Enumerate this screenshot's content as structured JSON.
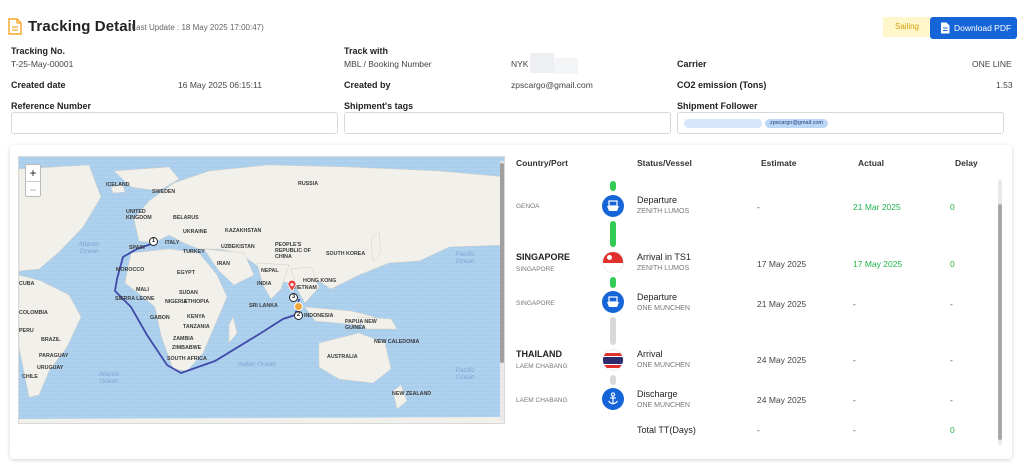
{
  "header": {
    "title": "Tracking Detail",
    "last_update": "(Last Update : 18 May 2025 17:00:47)",
    "status_badge": "Sailing",
    "download_label": "Download PDF"
  },
  "fields": {
    "tracking_no_label": "Tracking No.",
    "tracking_no": "T-25-May-00001",
    "track_with_label": "Track with",
    "track_with_type": "MBL / Booking Number",
    "track_with_value": "NYK",
    "carrier_label": "Carrier",
    "carrier": "ONE LINE",
    "created_date_label": "Created date",
    "created_date": "16 May 2025 06:15:11",
    "created_by_label": "Created by",
    "created_by": "zpscargo@gmail.com",
    "co2_label": "CO2 emission (Tons)",
    "co2": "1.53",
    "reference_label": "Reference Number",
    "tags_label": "Shipment's tags",
    "follower_label": "Shipment Follower",
    "follower_tag": "zpscargo@gmail.com"
  },
  "map": {
    "zoom_in": "+",
    "zoom_out": "−",
    "labels": [
      "ICELAND",
      "SWEDEN",
      "UNITED KINGDOM",
      "BELARUS",
      "UKRAINE",
      "SPAIN",
      "ITALY",
      "TURKEY",
      "KAZAKHSTAN",
      "UZBEKISTAN",
      "RUSSIA",
      "PEOPLE'S REPUBLIC OF CHINA",
      "SOUTH KOREA",
      "MOROCCO",
      "EGYPT",
      "IRAN",
      "NEPAL",
      "HONG KONG",
      "INDIA",
      "MALI",
      "NIGERIA",
      "SUDAN",
      "SIERRA LEONE",
      "ETHIOPIA",
      "SRI LANKA",
      "VIETNAM",
      "INDONESIA",
      "GABON",
      "KENYA",
      "TANZANIA",
      "ZAMBIA",
      "ZIMBABWE",
      "SOUTH AFRICA",
      "COLOMBIA",
      "PERU",
      "BRAZIL",
      "PARAGUAY",
      "CHILE",
      "URUGUAY",
      "CUBA",
      "PAPUA NEW GUINEA",
      "NEW CALEDONIA",
      "AUSTRALIA",
      "NEW ZEALAND",
      "Atlantic Ocean",
      "Atlantic Ocean",
      "Indian Ocean",
      "Pacific Ocean",
      "Pacific Ocean"
    ],
    "markers": [
      "1",
      "2",
      "3"
    ]
  },
  "table": {
    "headers": [
      "Country/Port",
      "Status/Vessel",
      "Estimate",
      "Actual",
      "Delay"
    ],
    "rows": [
      {
        "country": "",
        "port": "GENOA",
        "status": "Departure",
        "vessel": "ZENITH LUMOS",
        "estimate": "-",
        "actual": "21 Mar 2025",
        "delay": "0",
        "icon": "ship-icon"
      },
      {
        "country": "SINGAPORE",
        "port": "SINGAPORE",
        "status": "Arrival in TS1",
        "vessel": "ZENITH LUMOS",
        "estimate": "17 May 2025",
        "actual": "17 May 2025",
        "delay": "0",
        "icon": "singapore-flag-icon"
      },
      {
        "country": "",
        "port": "SINGAPORE",
        "status": "Departure",
        "vessel": "ONE MUNCHEN",
        "estimate": "21 May 2025",
        "actual": "-",
        "delay": "-",
        "icon": "ship-icon"
      },
      {
        "country": "THAILAND",
        "port": "LAEM CHABANG",
        "status": "Arrival",
        "vessel": "ONE MUNCHEN",
        "estimate": "24 May 2025",
        "actual": "-",
        "delay": "-",
        "icon": "thailand-flag-icon"
      },
      {
        "country": "",
        "port": "LAEM CHABANG",
        "status": "Discharge",
        "vessel": "ONE MUNCHEN",
        "estimate": "24 May 2025",
        "actual": "-",
        "delay": "-",
        "icon": "anchor-icon"
      }
    ],
    "total_label": "Total TT(Days)",
    "total_estimate": "-",
    "total_actual": "-",
    "total_delay": "0"
  },
  "colors": {
    "accent": "#1565d8",
    "green": "#22b24c",
    "done": "#33cc55",
    "pending": "#d9d9d9"
  }
}
